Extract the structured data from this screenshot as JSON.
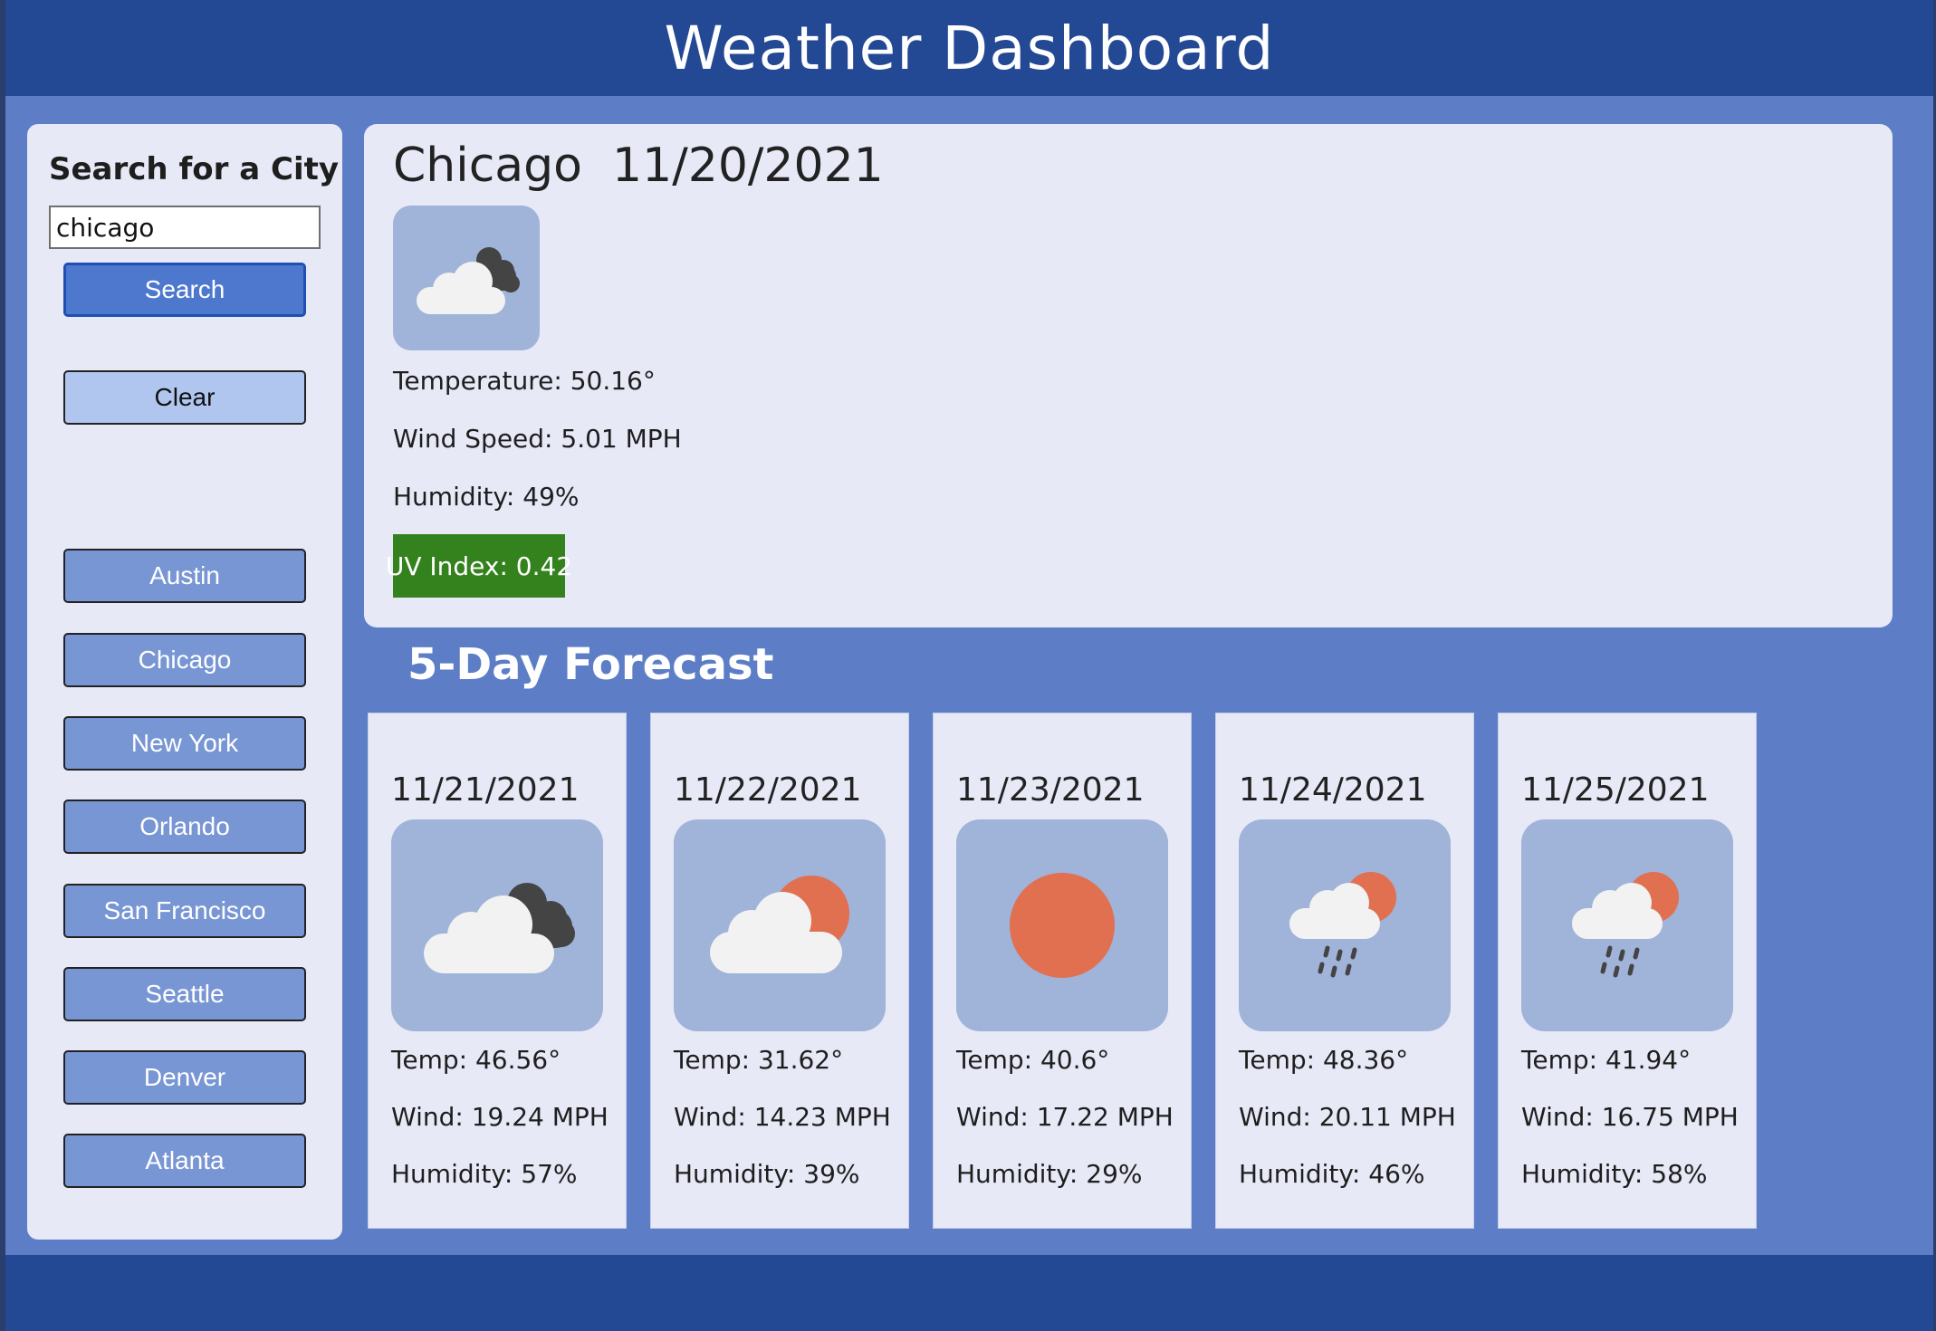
{
  "header": {
    "title": "Weather Dashboard"
  },
  "sidebar": {
    "title": "Search for a City",
    "search_value": "chicago",
    "search_label": "Search",
    "clear_label": "Clear",
    "cities": [
      "Austin",
      "Chicago",
      "New York",
      "Orlando",
      "San Francisco",
      "Seattle",
      "Denver",
      "Atlanta"
    ]
  },
  "current": {
    "title": "Chicago  11/20/2021",
    "icon": "cloudy-icon",
    "temperature": "Temperature: 50.16°",
    "wind": "Wind Speed: 5.01 MPH",
    "humidity": "Humidity: 49%",
    "uv": "UV Index: 0.42",
    "uv_color": "#34821d"
  },
  "forecast": {
    "heading": "5-Day Forecast",
    "days": [
      {
        "date": "11/21/2021",
        "icon": "cloudy-icon",
        "temp": "Temp: 46.56°",
        "wind": "Wind: 19.24 MPH",
        "humidity": "Humidity: 57%"
      },
      {
        "date": "11/22/2021",
        "icon": "partly-cloudy-icon",
        "temp": "Temp: 31.62°",
        "wind": "Wind: 14.23 MPH",
        "humidity": "Humidity: 39%"
      },
      {
        "date": "11/23/2021",
        "icon": "sun-icon",
        "temp": "Temp: 40.6°",
        "wind": "Wind: 17.22 MPH",
        "humidity": "Humidity: 29%"
      },
      {
        "date": "11/24/2021",
        "icon": "rain-sun-icon",
        "temp": "Temp: 48.36°",
        "wind": "Wind: 20.11 MPH",
        "humidity": "Humidity: 46%"
      },
      {
        "date": "11/25/2021",
        "icon": "rain-sun-icon",
        "temp": "Temp: 41.94°",
        "wind": "Wind: 16.75 MPH",
        "humidity": "Humidity: 58%"
      }
    ]
  },
  "colors": {
    "header": "#234894",
    "background": "#5d7ec6",
    "panel": "#e7e9f7",
    "search_button": "#4d78cd",
    "clear_button": "#b0c6ef",
    "city_button": "#7896d4",
    "icon_tile": "#a0b3d8",
    "sun": "#e07050"
  }
}
